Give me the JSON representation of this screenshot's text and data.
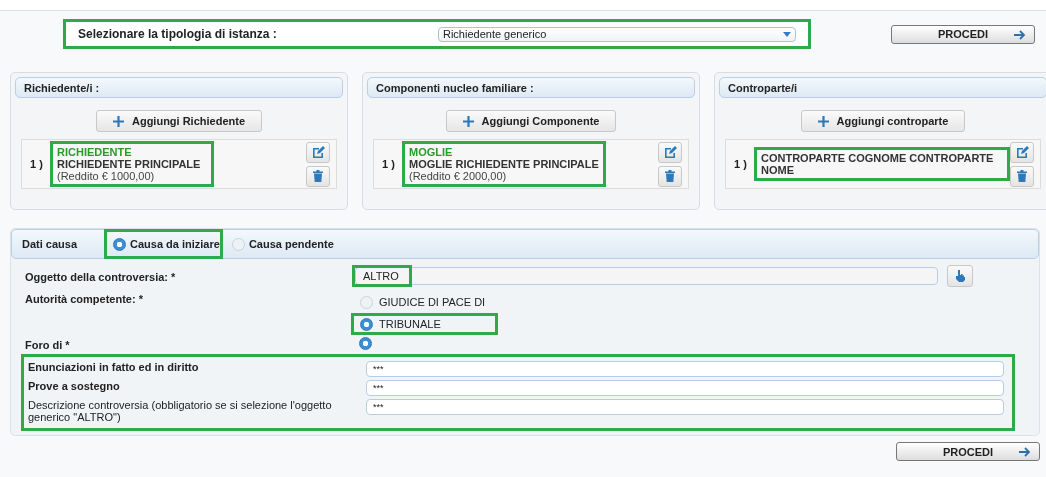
{
  "instance_type": {
    "label": "Selezionare la tipologia di istanza :",
    "value": "Richiedente generico",
    "highlighted": true
  },
  "top_button": "PROCEDI",
  "panels": [
    {
      "title": "Richiedente/i :",
      "add_button": "Aggiungi Richiedente",
      "items": [
        {
          "number": "1 )",
          "role": "RICHIEDENTE",
          "name": "RICHIEDENTE PRINCIPALE",
          "income": "(Reddito € 1000,00)",
          "highlighted": true
        }
      ]
    },
    {
      "title": "Componenti nucleo familiare :",
      "add_button": "Aggiungi Componente",
      "items": [
        {
          "number": "1 )",
          "role": "MOGLIE",
          "name": "MOGLIE RICHIEDENTE PRINCIPALE",
          "income": "(Reddito € 2000,00)",
          "highlighted": true
        }
      ]
    },
    {
      "title": "Controparte/i",
      "add_button": "Aggiungi controparte",
      "items": [
        {
          "number": "1 )",
          "name": "CONTROPARTE COGNOME CONTROPARTE NOME",
          "highlighted": true
        }
      ]
    }
  ],
  "cause": {
    "title": "Dati causa",
    "options": [
      {
        "label": "Causa da iniziare",
        "selected": true,
        "highlighted": true
      },
      {
        "label": "Causa pendente",
        "selected": false,
        "highlighted": false
      }
    ],
    "subject": {
      "label": "Oggetto della controversia: *",
      "value": "ALTRO",
      "highlighted": true
    },
    "authority": {
      "label": "Autorità competente: *",
      "options": [
        {
          "label": "GIUDICE DI PACE DI",
          "selected": false,
          "highlighted": false
        },
        {
          "label": "TRIBUNALE",
          "selected": true,
          "highlighted": true
        }
      ]
    },
    "forum": {
      "label": "Foro di *",
      "selected": true
    },
    "text_fields_highlighted": true,
    "text_fields": [
      {
        "label": "Enunciazioni in fatto ed in diritto",
        "value": "***",
        "bold": true
      },
      {
        "label": "Prove a sostegno",
        "value": "***",
        "bold": true
      },
      {
        "label": "Descrizione controversia (obbligatorio se si selezione l'oggetto generico \"ALTRO\")",
        "value": "***",
        "bold": false
      }
    ]
  },
  "bottom_button": "PROCEDI"
}
